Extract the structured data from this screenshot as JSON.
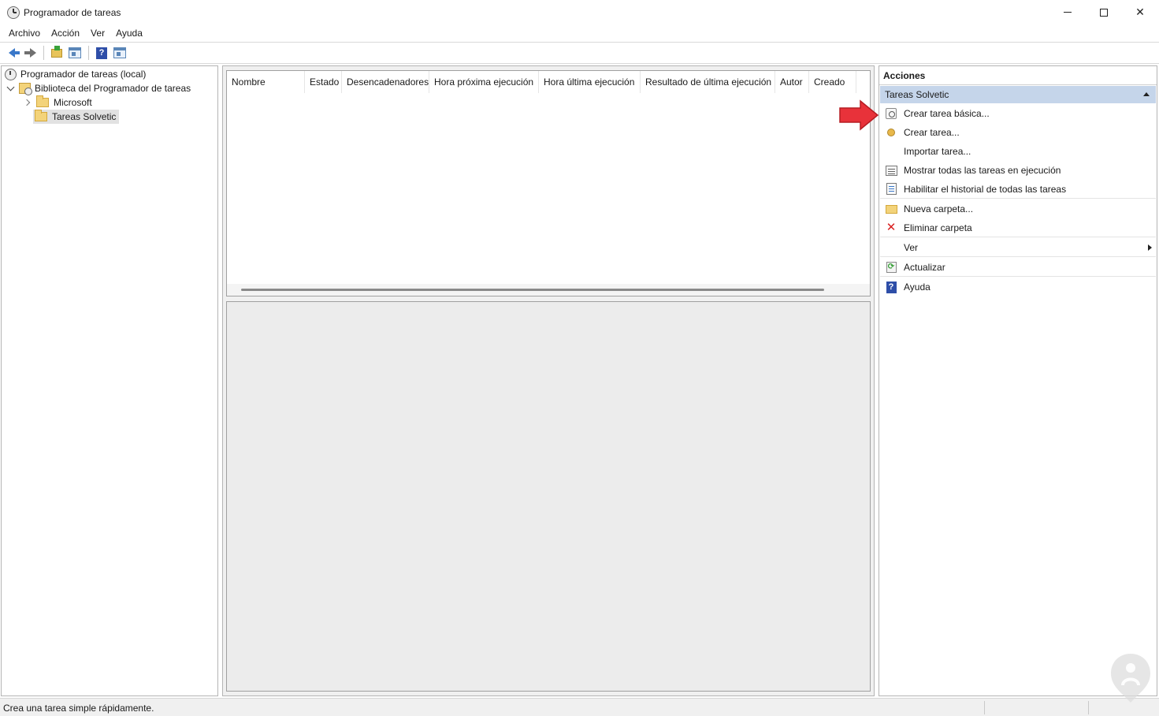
{
  "window": {
    "title": "Programador de tareas"
  },
  "menu": [
    "Archivo",
    "Acción",
    "Ver",
    "Ayuda"
  ],
  "tree": {
    "root": "Programador de tareas (local)",
    "library": "Biblioteca del Programador de tareas",
    "children": [
      "Microsoft",
      "Tareas Solvetic"
    ],
    "selected": "Tareas Solvetic"
  },
  "task_list": {
    "columns": [
      "Nombre",
      "Estado",
      "Desencadenadores",
      "Hora próxima ejecución",
      "Hora última ejecución",
      "Resultado de última ejecución",
      "Autor",
      "Creado"
    ],
    "rows": []
  },
  "actions": {
    "title": "Acciones",
    "section": "Tareas Solvetic",
    "items": [
      {
        "label": "Crear tarea básica...",
        "icon": "clock-document-icon"
      },
      {
        "label": "Crear tarea...",
        "icon": "task-icon"
      },
      {
        "label": "Importar tarea...",
        "icon": ""
      },
      {
        "label": "Mostrar todas las tareas en ejecución",
        "icon": "running-tasks-icon"
      },
      {
        "label": "Habilitar el historial de todas las tareas",
        "icon": "history-icon"
      },
      {
        "label": "Nueva carpeta...",
        "icon": "new-folder-icon"
      },
      {
        "label": "Eliminar carpeta",
        "icon": "delete-icon"
      },
      {
        "label": "Ver",
        "icon": ""
      },
      {
        "label": "Actualizar",
        "icon": "refresh-icon"
      },
      {
        "label": "Ayuda",
        "icon": "help-icon"
      }
    ]
  },
  "status": {
    "text": "Crea una tarea simple rápidamente."
  },
  "colors": {
    "section_header_bg": "#c5d5ea",
    "arrow_red": "#e8323a",
    "delete_red": "#d92020"
  }
}
